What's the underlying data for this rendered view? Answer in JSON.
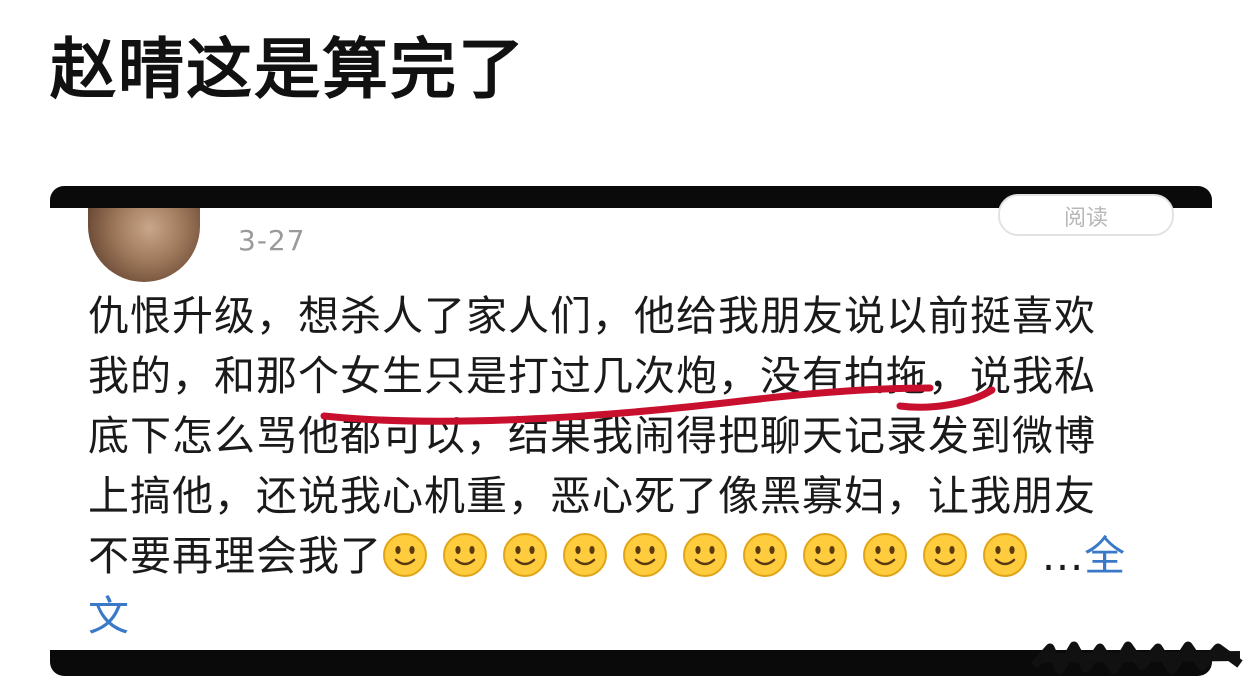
{
  "headline": "赵晴这是算完了",
  "post": {
    "date": "3-27",
    "read_button": "阅读",
    "lines": [
      "仇恨升级，想杀人了家人们，他给我朋友说以前挺喜欢",
      "我的，和那个女生只是打过几次炮，没有拍拖，说我私",
      "底下怎么骂他都可以，结果我闹得把聊天记录发到微博",
      "上搞他，还说我心机重，恶心死了像黑寡妇，让我朋友"
    ],
    "last_line_text": "不要再理会我了",
    "emoji_count": 11,
    "emoji_icon": "slightly-smiling-face-icon",
    "ellipsis": "...",
    "full_link_part1": "全",
    "full_link_part2": "文"
  },
  "colors": {
    "link": "#3a78c8",
    "underline": "#c8102e",
    "frame": "#0a0a0a"
  }
}
